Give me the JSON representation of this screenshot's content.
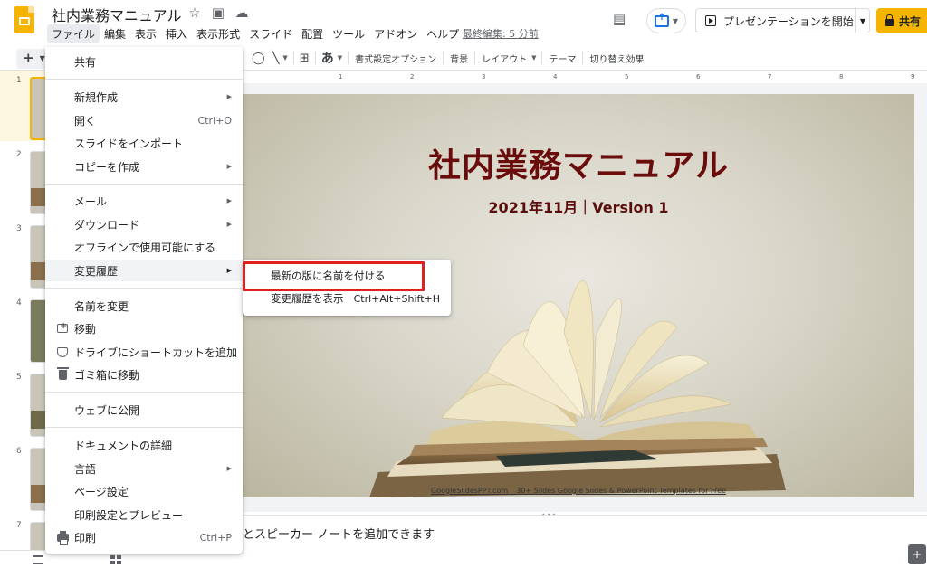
{
  "app": {
    "doc_title": "社内業務マニュアル",
    "last_edit": "最終編集: 5 分前"
  },
  "menubar": [
    "ファイル",
    "編集",
    "表示",
    "挿入",
    "表示形式",
    "スライド",
    "配置",
    "ツール",
    "アドオン",
    "ヘルプ"
  ],
  "header_buttons": {
    "present_label": "プレゼンテーションを開始",
    "share_label": "共有"
  },
  "toolbar": {
    "add_label": "+",
    "text_label": "あ",
    "format_options": "書式設定オプション",
    "background": "背景",
    "layout": "レイアウト",
    "theme": "テーマ",
    "transition": "切り替え効果"
  },
  "ruler_ticks": [
    "1",
    "2",
    "3",
    "4",
    "5",
    "6",
    "7",
    "8",
    "9"
  ],
  "filmstrip": {
    "slide_numbers": [
      "1",
      "2",
      "3",
      "4",
      "5",
      "6",
      "7"
    ],
    "selected_slide": 1
  },
  "file_menu": {
    "share": "共有",
    "new": "新規作成",
    "open": "開く",
    "open_shortcut": "Ctrl+O",
    "import_slides": "スライドをインポート",
    "make_copy": "コピーを作成",
    "email": "メール",
    "download": "ダウンロード",
    "offline": "オフラインで使用可能にする",
    "version_history": "変更履歴",
    "rename": "名前を変更",
    "move": "移動",
    "add_shortcut": "ドライブにショートカットを追加",
    "move_to_trash": "ゴミ箱に移動",
    "publish_web": "ウェブに公開",
    "doc_details": "ドキュメントの詳細",
    "language": "言語",
    "page_setup": "ページ設定",
    "print_preview": "印刷設定とプレビュー",
    "print": "印刷",
    "print_shortcut": "Ctrl+P"
  },
  "version_submenu": {
    "name_current": "最新の版に名前を付ける",
    "see_history": "変更履歴を表示",
    "see_history_shortcut": "Ctrl+Alt+Shift+H"
  },
  "slide": {
    "title": "社内業務マニュアル",
    "subtitle": "2021年11月｜Version 1",
    "footer": "GoogleSlidesPPT.com _ 30+ Slides Google Slides & PowerPoint Templates for Free"
  },
  "notes": {
    "placeholder": "とスピーカー ノートを追加できます"
  },
  "colors": {
    "brand_yellow": "#f4b400",
    "accent_blue": "#1a73e8",
    "title_maroon": "#6b0c0c",
    "highlight_red": "#e02020"
  }
}
